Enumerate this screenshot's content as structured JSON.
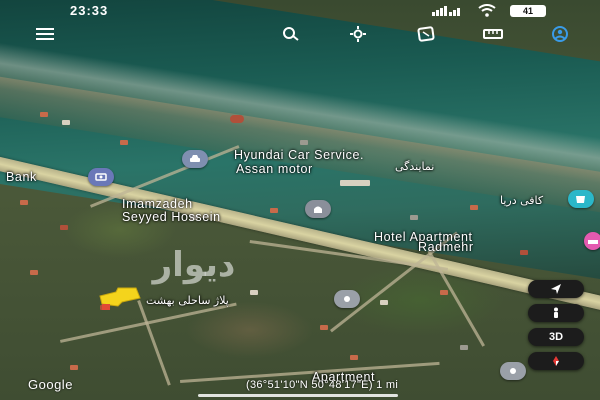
{
  "status_bar": {
    "time": "23:33",
    "battery": "41",
    "icons": [
      "signal-icon",
      "wifi-icon",
      "battery-icon"
    ]
  },
  "toolbar": {
    "icons": [
      "menu-icon",
      "search-icon",
      "settings-icon",
      "layers-icon",
      "ruler-icon",
      "profile-icon"
    ],
    "accent": "#3a9be8"
  },
  "map": {
    "labels": {
      "hyundai": "Hyundai Car Service.",
      "assan": "Assan motor",
      "assan_ar": "نمایندگی",
      "bank": "Bank",
      "imamzadeh": "Imamzadeh",
      "seyyed": "Seyyed Hossein",
      "hotel": "Hotel Apartment",
      "radmehr": "Radmehr",
      "cafe_ar": "کافی دریا",
      "plaza_ar": "پلاژ ساحلی بهشت",
      "bottom_partial": "Apartment"
    },
    "pin_colors": {
      "car": "#7f8fb0",
      "bank": "#6a78b8",
      "mosque": "#8a8f9a",
      "cafe": "#2bb7c9",
      "hotel": "#e45ab0",
      "beach": "#9aa0a8",
      "bottom": "#9aa0a8",
      "flag": "#f4d41c"
    }
  },
  "watermark": "دیوار",
  "controls": {
    "compass_icon": "navigation-arrow-icon",
    "walk_icon": "pegman-icon",
    "mode_3d": "3D",
    "location_icon": "compass-marker-icon"
  },
  "footer": {
    "logo": "Google",
    "coords": "(36°51'10\"N 50°48'17\"E) 1 mi"
  }
}
